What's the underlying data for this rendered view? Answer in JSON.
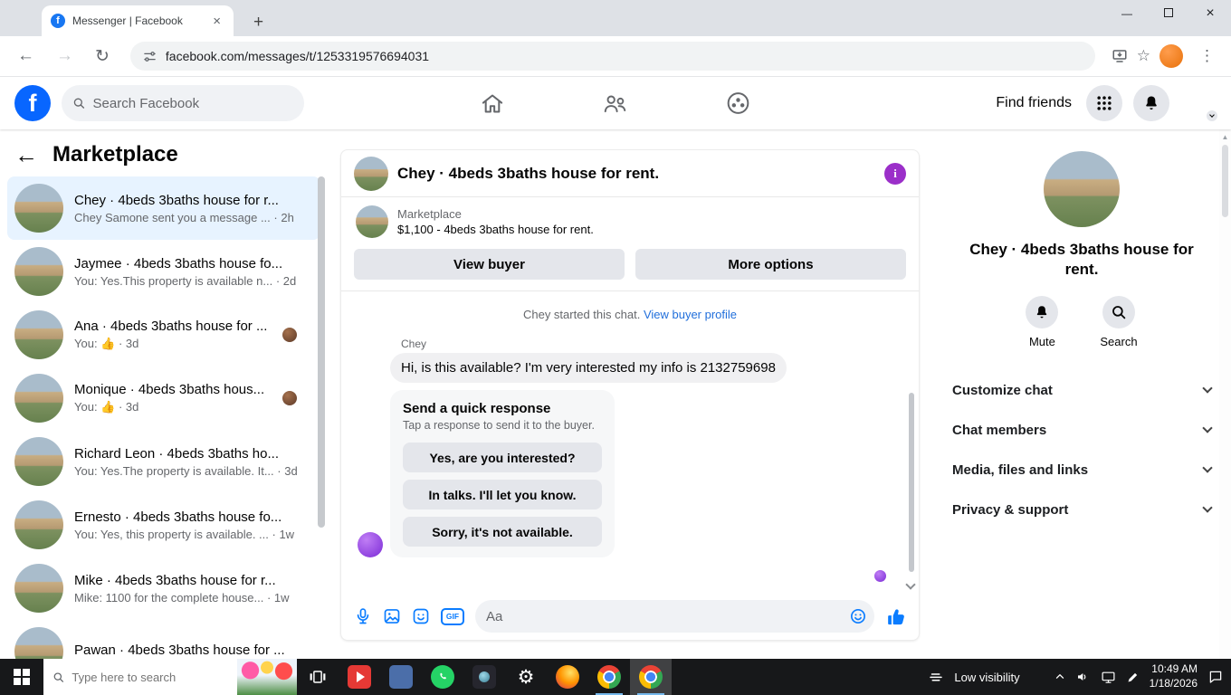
{
  "browser": {
    "tab_title": "Messenger | Facebook",
    "url": "facebook.com/messages/t/1253319576694031"
  },
  "glyphs": {
    "logo_f": "f",
    "info_i": "i",
    "back": "←",
    "forward": "→",
    "reload": "↻",
    "tab_close": "×",
    "new_tab": "+",
    "star": "☆",
    "menu_dots": "⋮",
    "minimize": "—",
    "window_close": "×",
    "scroll_up": "▲",
    "gear": "⚙",
    "marketplace_back": "←"
  },
  "fb": {
    "search_placeholder": "Search Facebook",
    "find_friends_label": "Find friends"
  },
  "sidebar": {
    "title": "Marketplace",
    "conversations": [
      {
        "title": "Chey · 4beds 3baths house for r...",
        "preview": "Chey Samone sent you a message ...",
        "time": "2h"
      },
      {
        "title": "Jaymee · 4beds 3baths house fo...",
        "preview": "You: Yes.This property is available n...",
        "time": "2d"
      },
      {
        "title": "Ana · 4beds 3baths house for ...",
        "preview": "You: 👍",
        "time": "3d"
      },
      {
        "title": "Monique · 4beds 3baths hous...",
        "preview": "You: 👍",
        "time": "3d"
      },
      {
        "title": "Richard Leon · 4beds 3baths ho...",
        "preview": "You: Yes.The property is available. It...",
        "time": "3d"
      },
      {
        "title": "Ernesto · 4beds 3baths house fo...",
        "preview": "You: Yes, this property is available. ...",
        "time": "1w"
      },
      {
        "title": "Mike · 4beds 3baths house for r...",
        "preview": "Mike: 1100 for the complete house...",
        "time": "1w"
      },
      {
        "title": "Pawan · 4beds 3baths house for ...",
        "preview": "",
        "time": ""
      }
    ]
  },
  "chat": {
    "title": "Chey · 4beds 3baths house for rent.",
    "marketplace_label": "Marketplace",
    "listing_line": "$1,100 - 4beds 3baths house for rent.",
    "view_buyer_button": "View buyer",
    "more_options_button": "More options",
    "chat_started_text": "Chey started this chat.",
    "view_buyer_profile_link": "View buyer profile",
    "sender_name": "Chey",
    "incoming_message": "Hi, is this available? I'm very interested my info is 2132759698",
    "quick_response_title": "Send a quick response",
    "quick_response_subtitle": "Tap a response to send it to the buyer.",
    "quick_responses": [
      "Yes, are you interested?",
      "In talks. I'll let you know.",
      "Sorry, it's not available."
    ],
    "composer_placeholder": "Aa",
    "gif_label": "GIF"
  },
  "details_panel": {
    "title": "Chey · 4beds 3baths house for rent.",
    "mute_label": "Mute",
    "search_label": "Search",
    "sections": [
      "Customize chat",
      "Chat members",
      "Media, files and links",
      "Privacy & support"
    ]
  },
  "taskbar": {
    "search_placeholder": "Type here to search",
    "widget_label": "Low visibility",
    "time": "10:49 AM",
    "date": "1/18/2026"
  },
  "colors": {
    "facebook_blue": "#0866ff",
    "messenger_icon_blue": "#0a7cff",
    "link_blue": "#216fdb",
    "chat_theme_purple": "#9b2fc9",
    "selected_conversation_bg": "#e7f3ff"
  }
}
